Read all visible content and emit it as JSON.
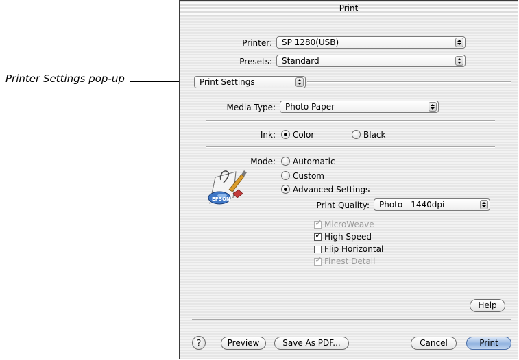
{
  "callout": {
    "text": "Printer Settings pop-up"
  },
  "window": {
    "title": "Print"
  },
  "printer": {
    "label": "Printer:",
    "value": "SP 1280(USB)"
  },
  "presets": {
    "label": "Presets:",
    "value": "Standard"
  },
  "panel": {
    "value": "Print Settings"
  },
  "media_type": {
    "label": "Media Type:",
    "value": "Photo Paper"
  },
  "ink": {
    "label": "Ink:",
    "options": [
      {
        "label": "Color",
        "selected": true
      },
      {
        "label": "Black",
        "selected": false
      }
    ]
  },
  "mode": {
    "label": "Mode:",
    "options": [
      {
        "label": "Automatic",
        "selected": false
      },
      {
        "label": "Custom",
        "selected": false
      },
      {
        "label": "Advanced Settings",
        "selected": true
      }
    ]
  },
  "logo": {
    "text": "EPSON"
  },
  "print_quality": {
    "label": "Print Quality:",
    "value": "Photo - 1440dpi"
  },
  "options": [
    {
      "label": "MicroWeave",
      "checked": true,
      "enabled": false
    },
    {
      "label": "High Speed",
      "checked": true,
      "enabled": true
    },
    {
      "label": "Flip Horizontal",
      "checked": false,
      "enabled": true
    },
    {
      "label": "Finest Detail",
      "checked": true,
      "enabled": false
    }
  ],
  "buttons": {
    "help": "Help",
    "question": "?",
    "preview": "Preview",
    "save_pdf": "Save As PDF...",
    "cancel": "Cancel",
    "print": "Print"
  }
}
